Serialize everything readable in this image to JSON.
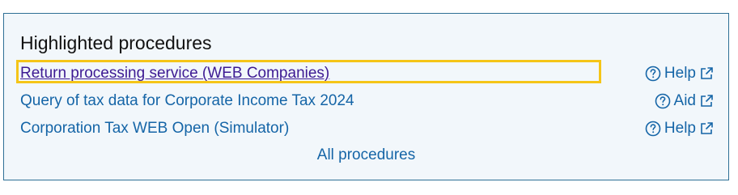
{
  "panel": {
    "title": "Highlighted procedures",
    "colors": {
      "border": "#2e6f95",
      "background": "#f2f7fb",
      "link": "#1565a7",
      "visited_link": "#3d1a93",
      "focus_outline": "#f5c518"
    }
  },
  "procedures": [
    {
      "label": "Return processing service (WEB Companies)",
      "help_label": "Help",
      "help_icon": "question-circle-icon",
      "external_icon": "external-link-icon",
      "focused": true
    },
    {
      "label": "Query of tax data for Corporate Income Tax 2024",
      "help_label": "Aid",
      "help_icon": "question-circle-icon",
      "external_icon": "external-link-icon",
      "focused": false
    },
    {
      "label": "Corporation Tax WEB Open (Simulator)",
      "help_label": "Help",
      "help_icon": "question-circle-icon",
      "external_icon": "external-link-icon",
      "focused": false
    }
  ],
  "footer": {
    "all_procedures_label": "All procedures"
  }
}
